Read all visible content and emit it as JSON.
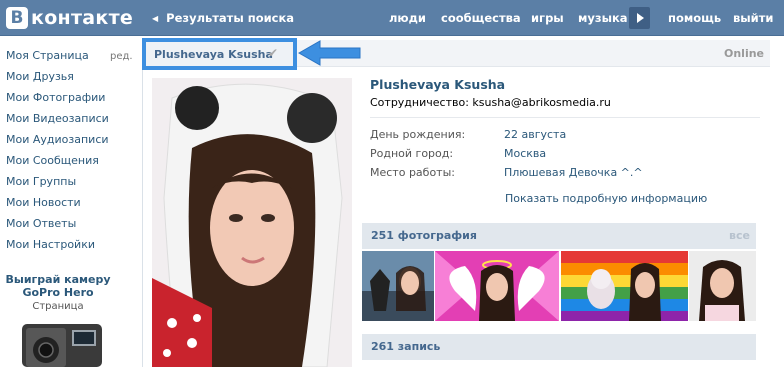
{
  "header": {
    "logo_letter": "В",
    "logo_text": "контакте",
    "back_label": "Результаты поиска",
    "nav": [
      "люди",
      "сообщества",
      "игры",
      "музыка",
      "помощь",
      "выйти"
    ]
  },
  "sidebar": {
    "edit_label": "ред.",
    "items": [
      "Моя Страница",
      "Мои Друзья",
      "Мои Фотографии",
      "Мои Видеозаписи",
      "Мои Аудиозаписи",
      "Мои Сообщения",
      "Мои Группы",
      "Мои Новости",
      "Мои Ответы",
      "Мои Настройки"
    ],
    "promo_title_1": "Выиграй камеру",
    "promo_title_2": "GoPro Hero",
    "promo_subtitle": "Страница"
  },
  "profile": {
    "header_name": "Plushevaya Ksusha",
    "online": "Online",
    "full_name": "Plushevaya Ksusha",
    "status": "Сотрудничество: ksusha@abrikosmedia.ru",
    "info": [
      {
        "label": "День рождения:",
        "value": "22 августа"
      },
      {
        "label": "Родной город:",
        "value": "Москва"
      },
      {
        "label": "Место работы:",
        "value": "Плюшевая Девочка ^.^"
      }
    ],
    "more_info": "Показать подробную информацию"
  },
  "photos_section": {
    "title": "251 фотография",
    "all": "все"
  },
  "posts_section": {
    "title": "261 запись"
  },
  "colors": {
    "brand": "#5b7fa6",
    "link": "#2b587a",
    "highlight": "#3d8fe0"
  }
}
